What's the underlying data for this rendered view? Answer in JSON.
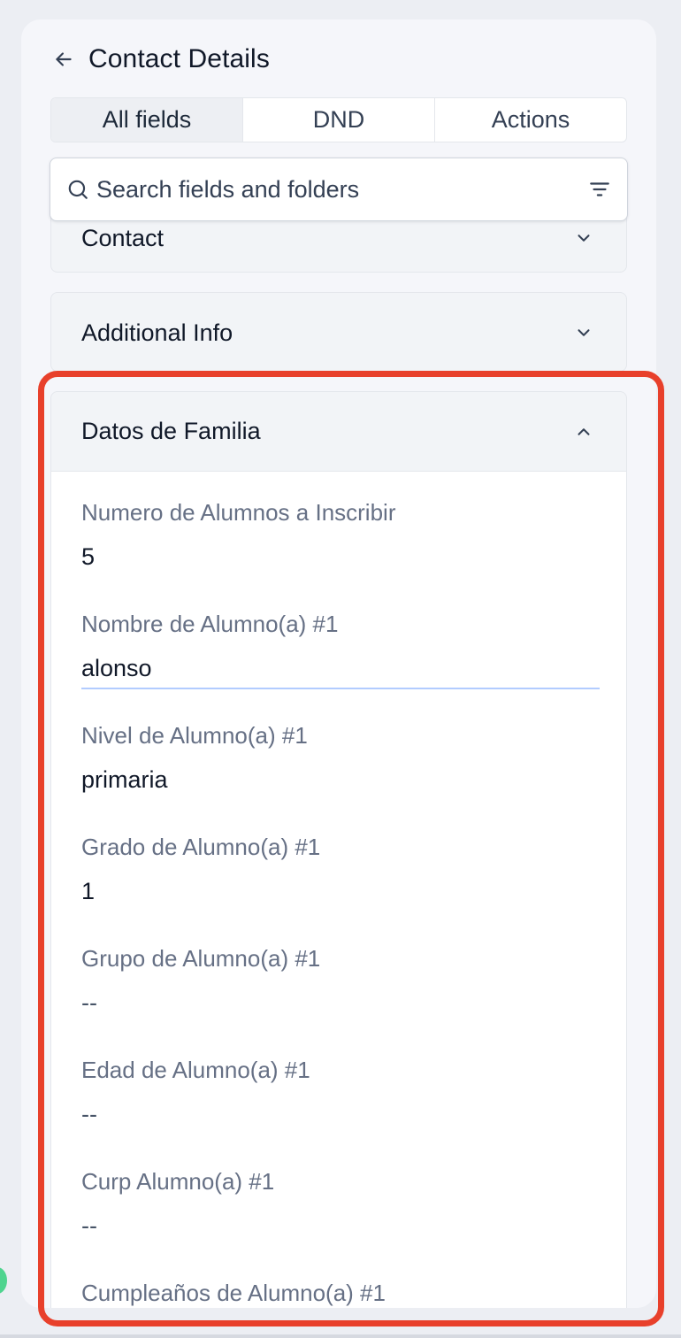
{
  "header": {
    "title": "Contact Details",
    "back_icon": "arrow-left-icon"
  },
  "tabs": [
    {
      "label": "All fields",
      "active": true
    },
    {
      "label": "DND",
      "active": false
    },
    {
      "label": "Actions",
      "active": false
    }
  ],
  "search": {
    "placeholder": "Search fields and folders",
    "value": ""
  },
  "sections": {
    "contact": {
      "title": "Contact",
      "expanded": false
    },
    "additional": {
      "title": "Additional Info",
      "expanded": false
    },
    "datos": {
      "title": "Datos de Familia",
      "expanded": true,
      "fields": [
        {
          "label": "Numero de Alumnos a Inscribir",
          "value": "5"
        },
        {
          "label": "Nombre de Alumno(a) #1",
          "value": "alonso"
        },
        {
          "label": "Nivel de Alumno(a) #1",
          "value": "primaria"
        },
        {
          "label": "Grado de Alumno(a) #1",
          "value": "1"
        },
        {
          "label": "Grupo de Alumno(a) #1",
          "value": "--"
        },
        {
          "label": "Edad de Alumno(a) #1",
          "value": "--"
        },
        {
          "label": "Curp Alumno(a) #1",
          "value": "--"
        },
        {
          "label": "Cumpleaños de Alumno(a) #1",
          "value": ""
        }
      ]
    }
  },
  "colors": {
    "highlight": "#e8402b",
    "panel": "#f5f6fa",
    "active_tab": "#edeff3"
  }
}
